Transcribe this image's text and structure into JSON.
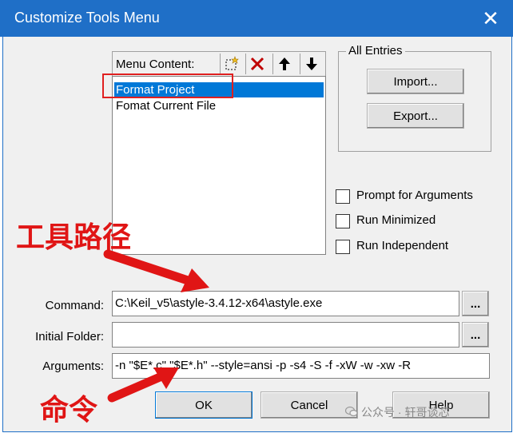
{
  "window": {
    "title": "Customize Tools Menu",
    "close_glyph": "✕"
  },
  "menu_content": {
    "label": "Menu Content:",
    "items": [
      {
        "label": "Format Project",
        "selected": true
      },
      {
        "label": "Fomat Current File",
        "selected": false
      }
    ],
    "toolbar_icons": [
      "new-item-icon",
      "delete-icon",
      "move-up-icon",
      "move-down-icon"
    ]
  },
  "all_entries": {
    "legend": "All Entries",
    "import_label": "Import...",
    "export_label": "Export..."
  },
  "options": {
    "prompt_args": "Prompt for  Arguments",
    "run_minimized": "Run Minimized",
    "run_independent": "Run Independent"
  },
  "fields": {
    "command_label": "Command:",
    "command_value": "C:\\Keil_v5\\astyle-3.4.12-x64\\astyle.exe",
    "folder_label": "Initial Folder:",
    "folder_value": "",
    "args_label": "Arguments:",
    "args_value": "-n \"$E*.c\" \"$E*.h\" --style=ansi -p -s4 -S -f -xW -w -xw -R",
    "browse_label": "..."
  },
  "buttons": {
    "ok": "OK",
    "cancel": "Cancel",
    "help": "Help"
  },
  "annotations": {
    "tool_path": "工具路径",
    "command": "命令"
  },
  "watermark": "公众号 · 轩哥谈芯",
  "colors": {
    "titlebar": "#1f6fc7",
    "selection": "#0078d7",
    "annotation_red": "#e01515"
  }
}
